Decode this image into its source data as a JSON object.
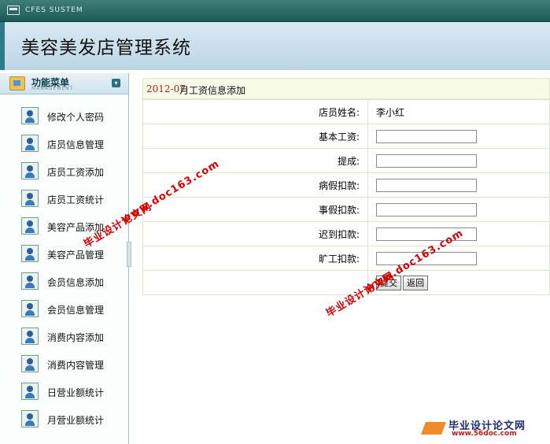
{
  "topbar": {
    "system_label": "CFES SUSTEM"
  },
  "banner": {
    "title": "美容美发店管理系统"
  },
  "sidebar": {
    "menu_title": "功能菜单",
    "menu_subtitle": "MANAGEMENT",
    "items": [
      {
        "label": "修改个人密码"
      },
      {
        "label": "店员信息管理"
      },
      {
        "label": "店员工资添加"
      },
      {
        "label": "店员工资统计"
      },
      {
        "label": "美容产品添加"
      },
      {
        "label": "美容产品管理"
      },
      {
        "label": "会员信息添加"
      },
      {
        "label": "会员信息管理"
      },
      {
        "label": "消费内容添加"
      },
      {
        "label": "消费内容管理"
      },
      {
        "label": "日营业额统计"
      },
      {
        "label": "月营业额统计"
      }
    ]
  },
  "form": {
    "header_year_month": "2012-07",
    "header_text": "月工资信息添加",
    "employee_label": "店员姓名:",
    "employee_name": "李小红",
    "fields": [
      {
        "label": "基本工资:",
        "value": ""
      },
      {
        "label": "提成:",
        "value": ""
      },
      {
        "label": "病假扣款:",
        "value": ""
      },
      {
        "label": "事假扣款:",
        "value": ""
      },
      {
        "label": "迟到扣款:",
        "value": ""
      },
      {
        "label": "旷工扣款:",
        "value": ""
      }
    ],
    "submit_label": "提交",
    "back_label": "返回"
  },
  "watermark": {
    "cn": "毕业设计论文网",
    "url": "www.doc163.com"
  },
  "footer_logo": {
    "cn": "毕业设计论文网",
    "url": "www.56doc.com"
  }
}
